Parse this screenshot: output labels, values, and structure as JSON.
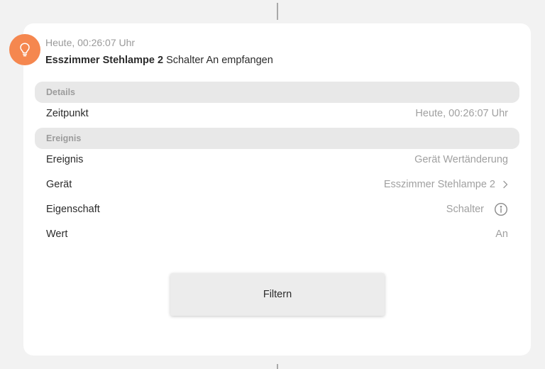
{
  "event": {
    "time": "Heute, 00:26:07 Uhr",
    "device_name": "Esszimmer Stehlampe 2",
    "message": "Schalter An empfangen",
    "icon": "lightbulb-icon",
    "icon_color": "#f5874f"
  },
  "sections": {
    "details": {
      "header": "Details",
      "rows": [
        {
          "label": "Zeitpunkt",
          "value": "Heute, 00:26:07 Uhr"
        }
      ]
    },
    "ereignis": {
      "header": "Ereignis",
      "rows": [
        {
          "label": "Ereignis",
          "value": "Gerät Wertänderung"
        },
        {
          "label": "Gerät",
          "value": "Esszimmer Stehlampe 2"
        },
        {
          "label": "Eigenschaft",
          "value": "Schalter"
        },
        {
          "label": "Wert",
          "value": "An"
        }
      ]
    }
  },
  "actions": {
    "filter_label": "Filtern"
  }
}
